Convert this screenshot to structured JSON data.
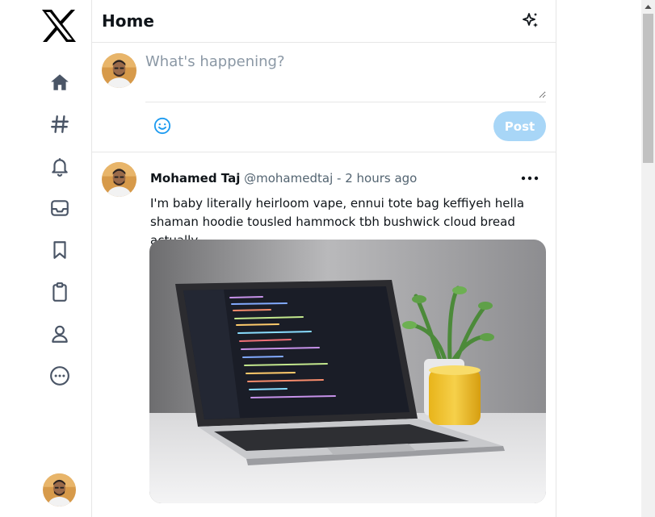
{
  "sidebar": {
    "logo": "x-logo-icon",
    "nav": [
      {
        "name": "home",
        "icon": "home-icon"
      },
      {
        "name": "explore",
        "icon": "hashtag-icon"
      },
      {
        "name": "notifications",
        "icon": "bell-icon"
      },
      {
        "name": "messages",
        "icon": "inbox-icon"
      },
      {
        "name": "bookmarks",
        "icon": "bookmark-icon"
      },
      {
        "name": "lists",
        "icon": "clipboard-icon"
      },
      {
        "name": "profile",
        "icon": "user-icon"
      },
      {
        "name": "more",
        "icon": "more-circle-icon"
      }
    ]
  },
  "header": {
    "title": "Home",
    "action_icon": "sparkle-icon"
  },
  "composer": {
    "placeholder": "What's happening?",
    "value": "",
    "emoji_icon": "smiley-icon",
    "post_label": "Post"
  },
  "tweet": {
    "name": "Mohamed Taj",
    "handle": "@mohamedtaj",
    "separator": "-",
    "time": "2 hours ago",
    "text": "I'm baby literally heirloom vape, ennui tote bag keffiyeh hella shaman hoodie tousled hammock tbh bushwick cloud bread actually.",
    "more_icon": "ellipsis-icon"
  },
  "colors": {
    "accent": "#1d9bf0",
    "post_disabled": "#a8d6f7",
    "icon": "#4a5566",
    "border": "#e6e6e6",
    "muted_text": "#536471"
  }
}
